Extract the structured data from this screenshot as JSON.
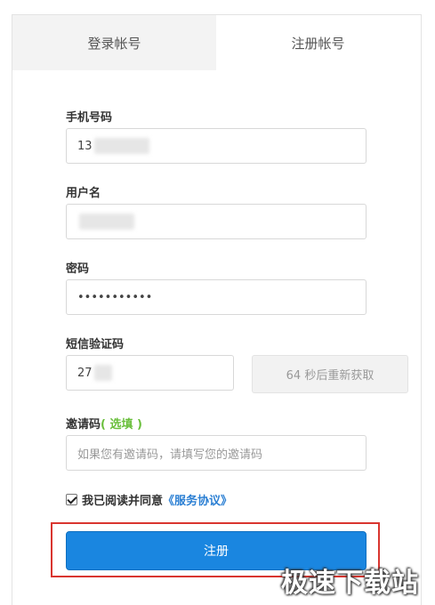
{
  "tabs": {
    "login": "登录帐号",
    "register": "注册帐号"
  },
  "form": {
    "phone_label": "手机号码",
    "phone_value": "13",
    "username_label": "用户名",
    "password_label": "密码",
    "password_value": "•••••••••••",
    "sms_label": "短信验证码",
    "sms_value": "27",
    "resend_label": "64 秒后重新获取",
    "invite_label": "邀请码",
    "invite_optional": "( 选填 )",
    "invite_placeholder": "如果您有邀请码，请填写您的邀请码",
    "agree_text": "我已阅读并同意",
    "agree_link": "《服务协议》",
    "agree_checked": true,
    "submit_label": "注册"
  },
  "watermark": "极速下载站",
  "colors": {
    "primary": "#1a86e0",
    "optional_green": "#6abf3c",
    "link_blue": "#2b7fd3",
    "highlight_red": "#d9352f"
  }
}
